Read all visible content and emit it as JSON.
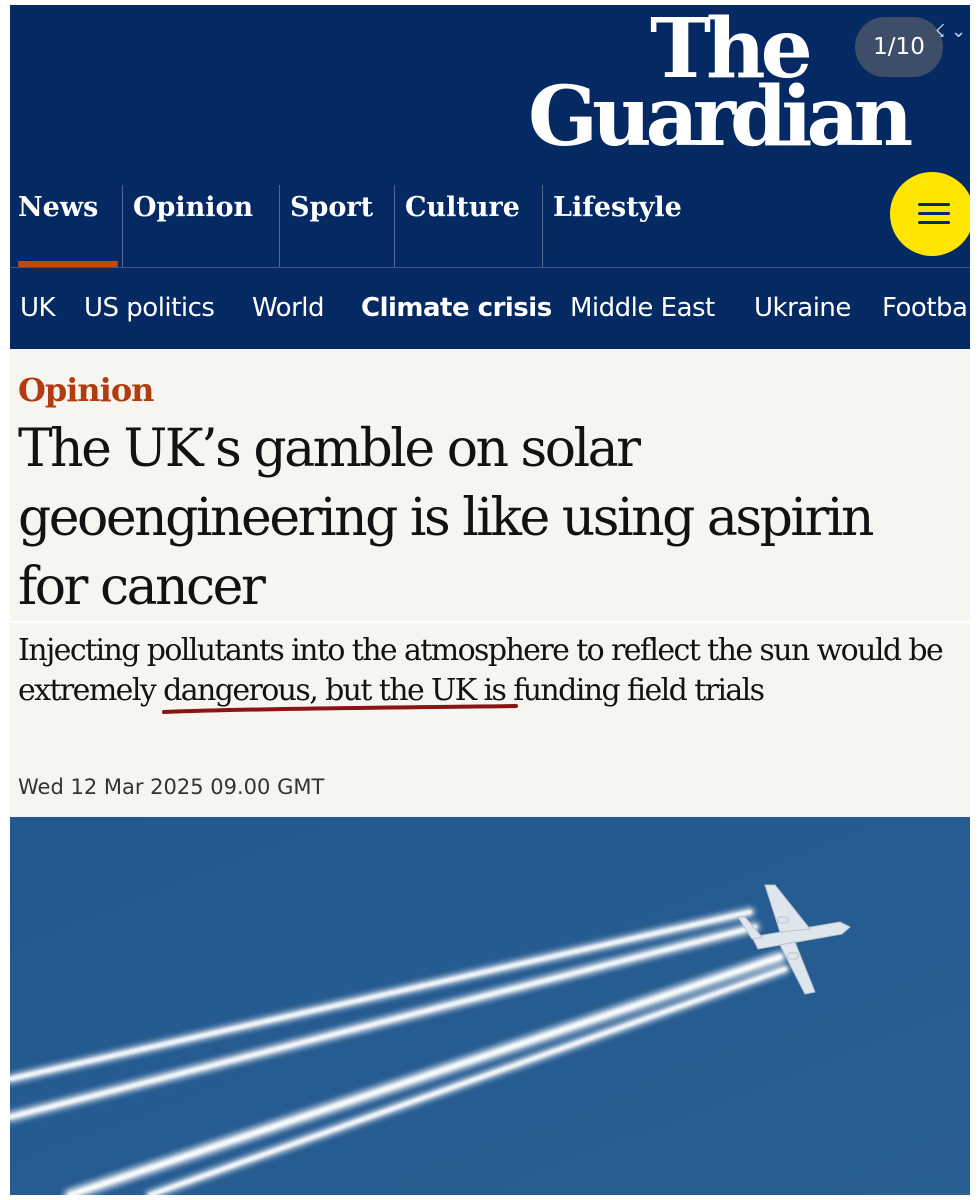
{
  "viewer": {
    "counter": "1/10",
    "corner_glyph": "☇ ⌄"
  },
  "masthead": {
    "logo_line1": "The",
    "logo_line2": "Guardian",
    "pillars": [
      "News",
      "Opinion",
      "Sport",
      "Culture",
      "Lifestyle"
    ],
    "active_pillar": "News",
    "accent_color": "#c74600",
    "background_color": "#052962",
    "menu_button_color": "#ffe500"
  },
  "subnav": {
    "items": [
      "UK",
      "US politics",
      "World",
      "Climate crisis",
      "Middle East",
      "Ukraine",
      "Footba"
    ],
    "active": "Climate crisis"
  },
  "article": {
    "kicker": "Opinion",
    "headline": "The UK’s gamble on solar geoengineering is like using aspirin for cancer",
    "standfirst": "Injecting pollutants into the atmosphere to reflect the sun would be extremely dangerous, but the UK is funding field trials",
    "dateline": "Wed 12 Mar 2025 09.00 GMT"
  },
  "image": {
    "subject": "airplane-with-contrails"
  }
}
